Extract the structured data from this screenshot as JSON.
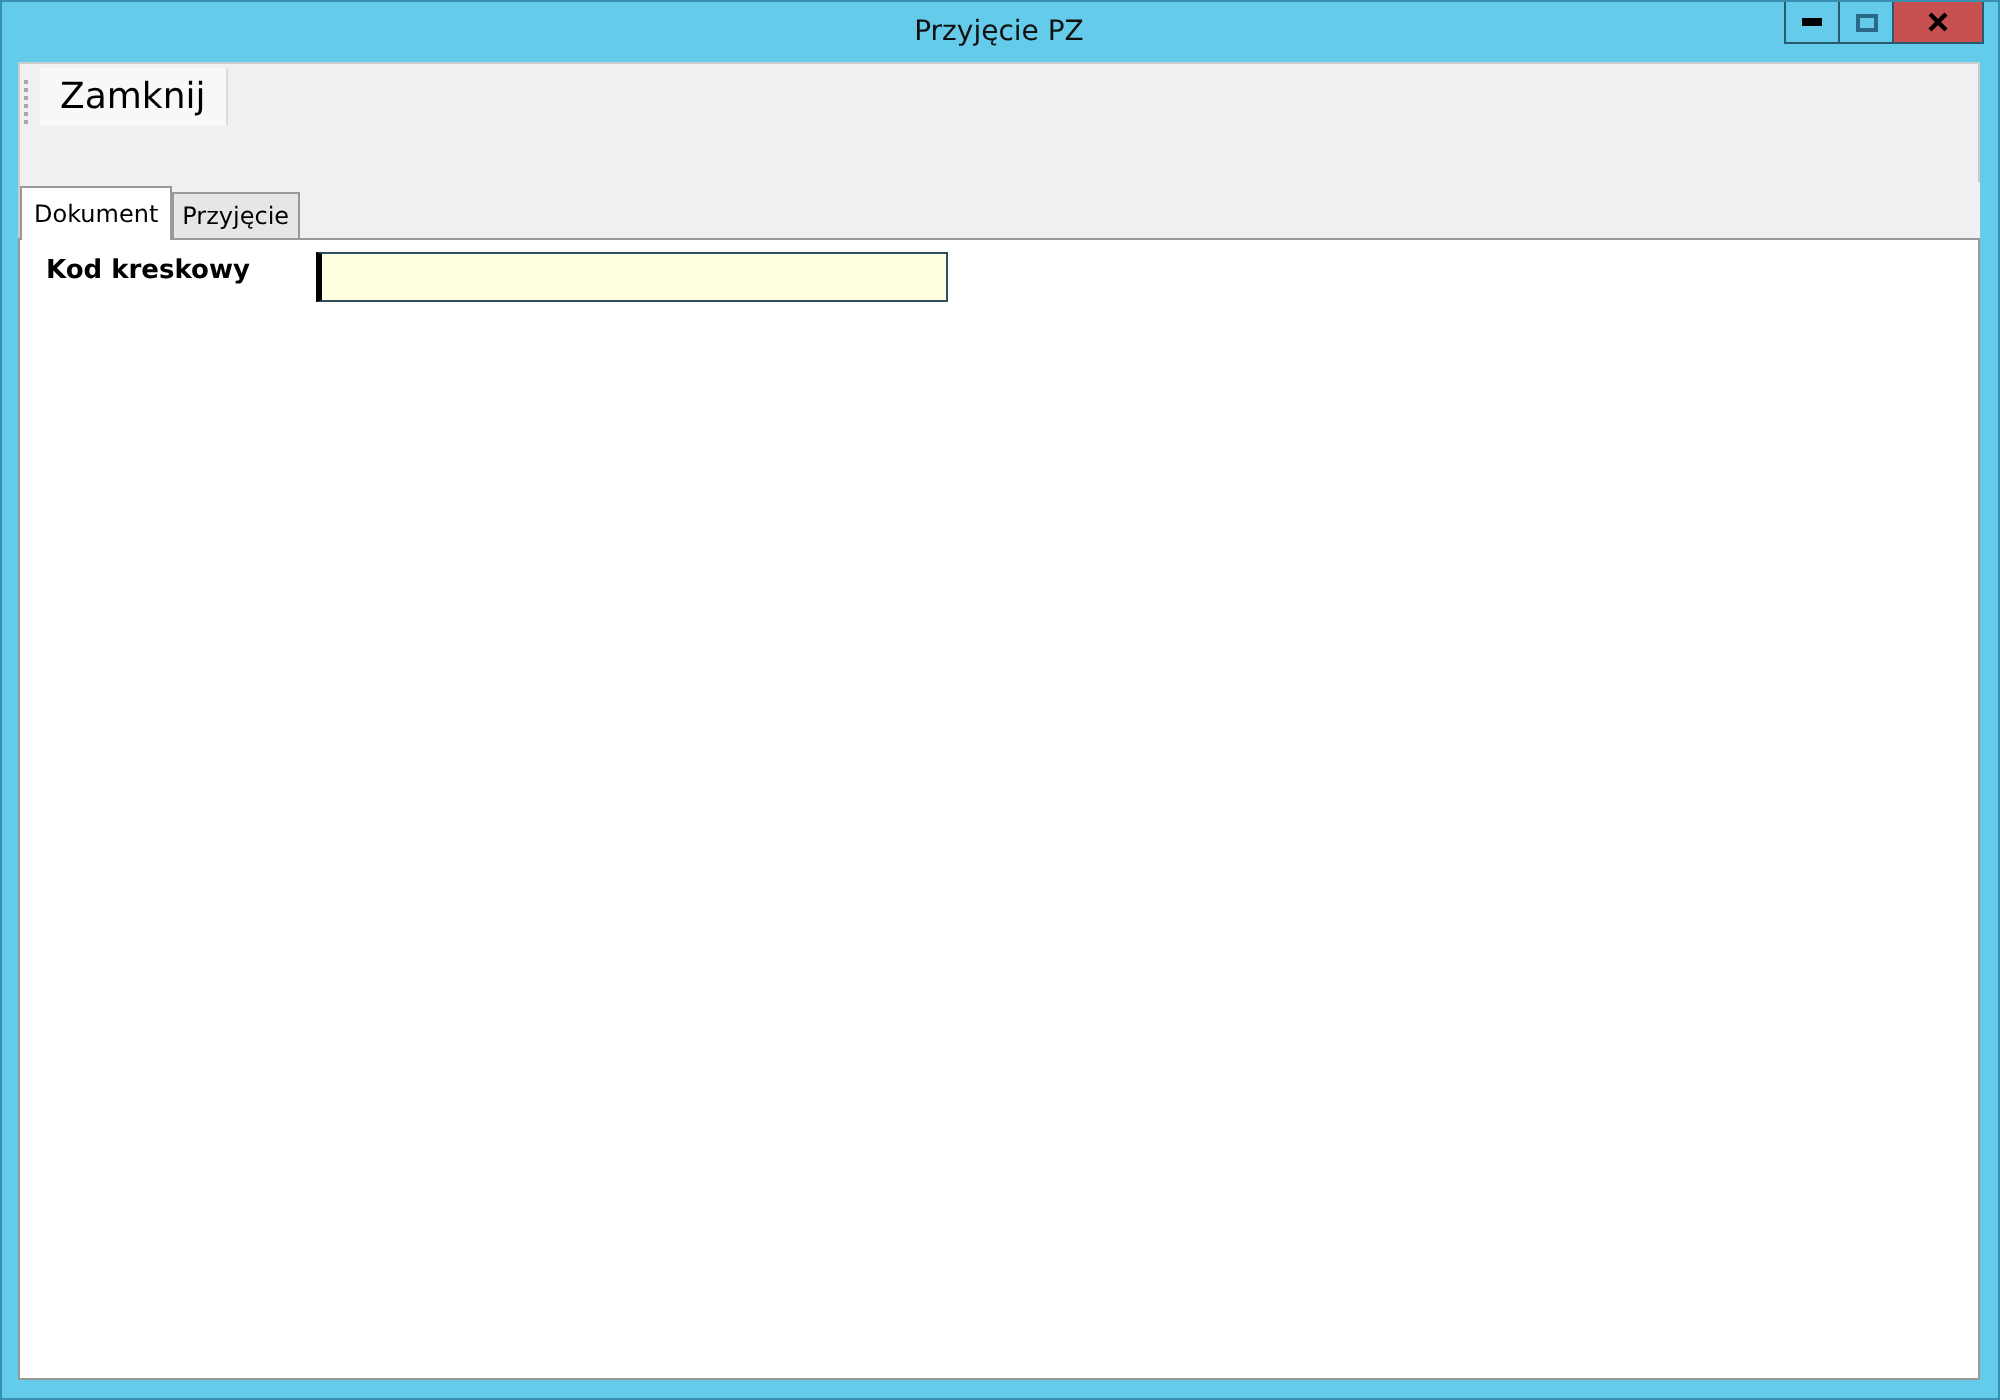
{
  "window": {
    "title": "Przyjęcie PZ"
  },
  "toolbar": {
    "buttons": [
      "Zamknij"
    ]
  },
  "tabs": [
    {
      "label": "Dokument",
      "selected": true
    },
    {
      "label": "Przyjęcie",
      "selected": false
    }
  ],
  "form": {
    "fields": [
      {
        "label": "Kod kreskowy",
        "focused": true
      }
    ]
  }
}
